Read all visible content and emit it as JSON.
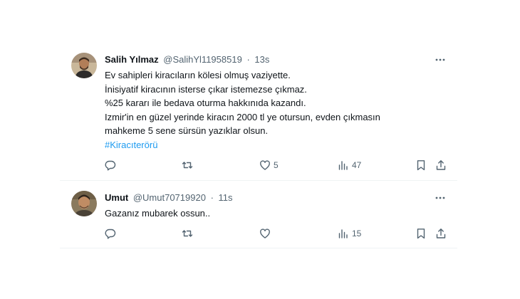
{
  "tweets": [
    {
      "display_name": "Salih Yılmaz",
      "handle": "@SalihYl11958519",
      "separator": "·",
      "time": "13s",
      "lines": [
        "Ev sahipleri kiracıların kölesi olmuş vaziyette.",
        "İnisiyatif kiracının isterse çıkar istemezse çıkmaz.",
        "%25 kararı ile bedava oturma hakkınıda kazandı.",
        "Izmir'in en güzel yerinde kiracın 2000 tl ye otursun, evden çıkmasın",
        "mahkeme 5 sene sürsün yazıklar olsun."
      ],
      "hashtag": "#Kiracıterörü",
      "replies": "",
      "retweets": "",
      "likes": "5",
      "views": "47"
    },
    {
      "display_name": "Umut",
      "handle": "@Umut70719920",
      "separator": "·",
      "time": "11s",
      "lines": [
        "Gazanız mubarek ossun.."
      ],
      "replies": "",
      "retweets": "",
      "likes": "",
      "views": "15"
    }
  ],
  "colors": {
    "text": "#0f1419",
    "secondary": "#536471",
    "link": "#1d9bf0",
    "divider": "#eff3f4"
  },
  "icons": [
    "reply-icon",
    "retweet-icon",
    "like-icon",
    "views-icon",
    "bookmark-icon",
    "share-icon",
    "more-icon"
  ]
}
